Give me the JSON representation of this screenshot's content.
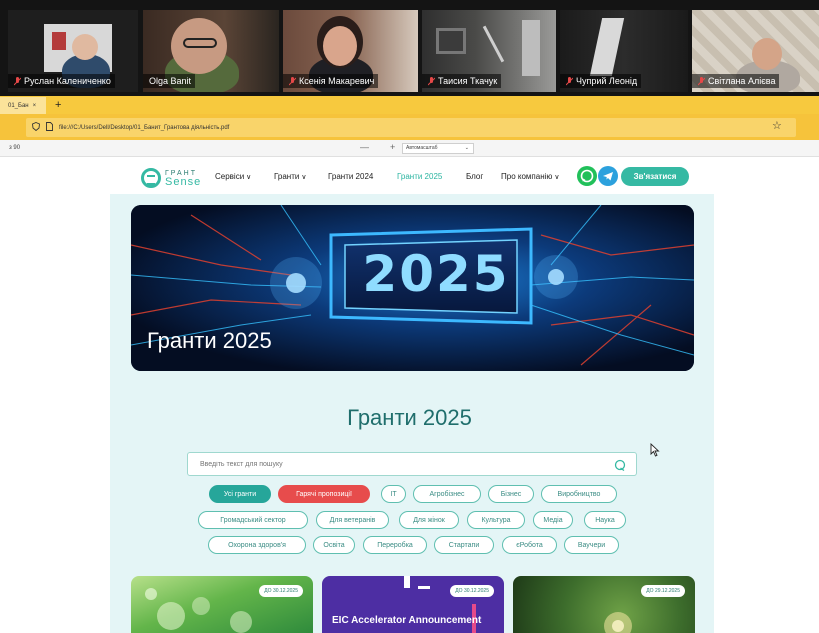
{
  "call": {
    "participants": [
      {
        "name": "Руслан Калениченко",
        "active": false
      },
      {
        "name": "Olga Banit",
        "active": true
      },
      {
        "name": "Ксенія Макаревич",
        "active": false
      },
      {
        "name": "Таисия Ткачук",
        "active": false
      },
      {
        "name": "Чуприй Леонід",
        "active": false
      },
      {
        "name": "Світлана Алієва",
        "active": false
      }
    ],
    "muted_icon": "mic-off-icon"
  },
  "browser": {
    "tab_title": "01_Бан",
    "tab_close": "×",
    "new_tab": "+",
    "url": "file:///C:/Users/Dell/Desktop/01_Банит_Грантова діяльність.pdf",
    "star": "☆",
    "pdf_page": "з 90",
    "zoom_minus": "—",
    "zoom_plus": "+",
    "zoom_value": "Автомасштаб",
    "colors": {
      "chrome": "#f6c33b",
      "tab": "#fbe39a"
    }
  },
  "site": {
    "logo_top": "ГРАНТ",
    "logo_bottom": "Sense",
    "nav": [
      {
        "label": "Сервіси",
        "dropdown": true
      },
      {
        "label": "Гранти",
        "dropdown": true
      },
      {
        "label": "Гранти 2024",
        "dropdown": false
      },
      {
        "label": "Гранти 2025",
        "dropdown": false,
        "current": true
      },
      {
        "label": "Блог",
        "dropdown": false
      },
      {
        "label": "Про компанію",
        "dropdown": true
      }
    ],
    "contact_label": "Зв'язатися",
    "hero_title": "Гранти 2025",
    "hero_year": "2025",
    "page_title": "Гранти 2025",
    "search_placeholder": "Введіть текст для пошуку",
    "filters": [
      [
        "Усі гранти",
        "Гарячі пропозиції",
        "IT",
        "Агробізнес",
        "Бізнес",
        "Виробництво"
      ],
      [
        "Громадський сектор",
        "Для ветеранів",
        "Для жінок",
        "Культура",
        "Медіа",
        "Наука"
      ],
      [
        "Охорона здоров'я",
        "Освіта",
        "Переробка",
        "Стартапи",
        "єРобота",
        "Ваучери"
      ]
    ],
    "cards": [
      {
        "date": "ДО 30.12.2025",
        "title": ""
      },
      {
        "date": "ДО 30.12.2025",
        "title": "EIC Accelerator Announcement"
      },
      {
        "date": "ДО 29.12.2025",
        "title": ""
      }
    ],
    "colors": {
      "accent": "#35b9a3",
      "hot": "#e74c4c",
      "panel": "#e4f5f6",
      "title": "#1f6e6c"
    }
  }
}
